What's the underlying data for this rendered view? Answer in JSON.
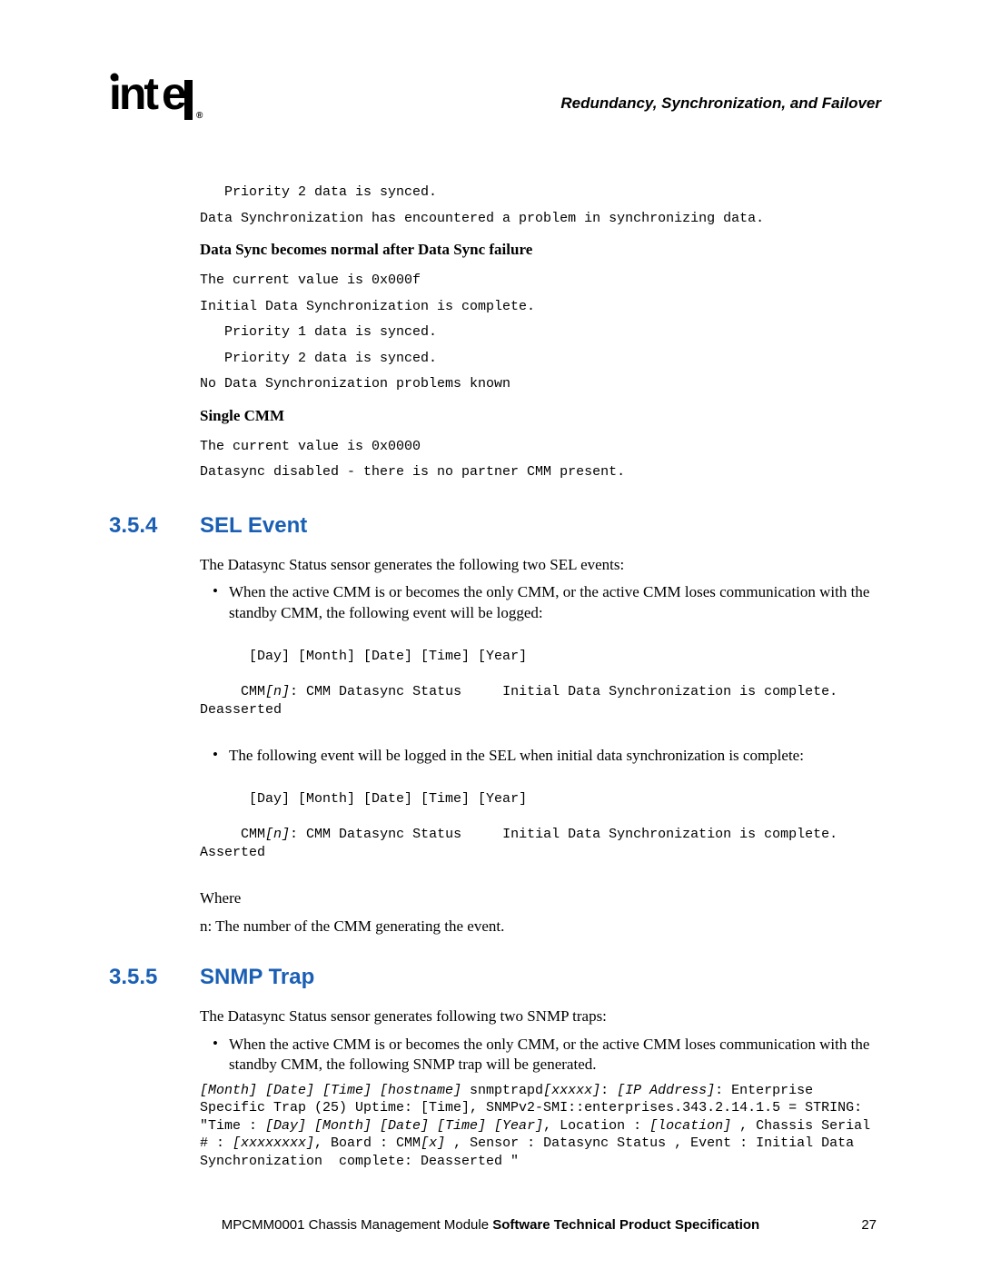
{
  "header": {
    "title": "Redundancy, Synchronization, and Failover"
  },
  "top_mono_1": "   Priority 2 data is synced.",
  "top_mono_2": "Data Synchronization has encountered a problem in synchronizing data.",
  "sub1": "Data Sync becomes normal after Data Sync failure",
  "block2_l1": "The current value is 0x000f",
  "block2_l2": "Initial Data Synchronization is complete.",
  "block2_l3": "   Priority 1 data is synced.",
  "block2_l4": "   Priority 2 data is synced.",
  "block2_l5": "No Data Synchronization problems known",
  "sub2": "Single CMM",
  "block3_l1": "The current value is 0x0000",
  "block3_l2": "Datasync disabled - there is no partner CMM present.",
  "sec354_num": "3.5.4",
  "sec354_title": "SEL Event",
  "sec354_intro": "The Datasync Status sensor generates the following two SEL events:",
  "sec354_b1": "When the active CMM is or becomes the only CMM, or the active CMM loses communication with the standby CMM, the following event will be logged:",
  "sel_ts": "[Day] [Month] [Date] [Time] [Year]",
  "sel_pre1": "     CMM",
  "sel_n": "[n]",
  "sel_post1": ": CMM Datasync Status     Initial Data Synchronization is complete. Deasserted",
  "sec354_b2": "The following event will be logged in the SEL when initial data synchronization is complete:",
  "sel_post2": ": CMM Datasync Status     Initial Data Synchronization is complete. Asserted",
  "where": "Where",
  "where_n": "n: The number of the CMM generating the event.",
  "sec355_num": "3.5.5",
  "sec355_title": "SNMP Trap",
  "sec355_intro": "The Datasync Status sensor generates following two SNMP traps:",
  "sec355_b1": "When the active CMM is or becomes the only CMM, or the active CMM loses communication with the standby CMM, the following SNMP trap will be generated.",
  "snmp_i1": "[Month] [Date] [Time] [hostname]",
  "snmp_p1": " snmptrapd",
  "snmp_i2": "[xxxxx]",
  "snmp_p2": ": ",
  "snmp_i3": "[IP Address]",
  "snmp_p3": ": Enterprise Specific Trap (25) Uptime: [Time], SNMPv2-SMI::enterprises.343.2.14.1.5 = STRING: \"Time : ",
  "snmp_i4": "[Day] [Month] [Date] [Time] [Year]",
  "snmp_p4": ", Location : ",
  "snmp_i5": "[location]",
  "snmp_p5": " , Chassis Serial # : ",
  "snmp_i6": "[xxxxxxxx]",
  "snmp_p6": ", Board : CMM",
  "snmp_i7": "[x]",
  "snmp_p7": " , Sensor : Datasync Status , Event : Initial Data Synchronization  complete: Deasserted \"",
  "footer_pre": "MPCMM0001 Chassis Management Module ",
  "footer_bold": "Software Technical Product Specification",
  "page_num": "27"
}
